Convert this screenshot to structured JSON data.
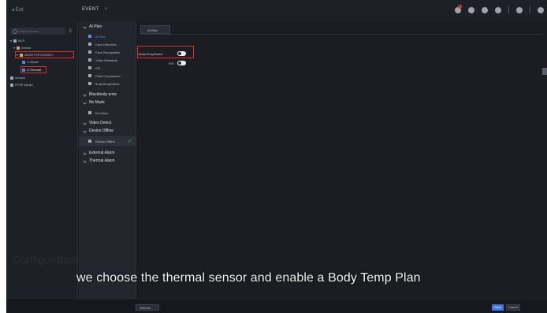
{
  "topbar": {
    "exit_label": "◂ Exit",
    "event_tab": "EVENT",
    "event_tab_plus": "+"
  },
  "devices": {
    "search_placeholder": "Search Device",
    "tree": [
      {
        "label": "NVS",
        "level": 0
      },
      {
        "label": "Device",
        "level": 1
      },
      {
        "label": "ANVR F2P4 E02027",
        "level": 2
      },
      {
        "label": "1-Visual",
        "level": 3
      },
      {
        "label": "2-Thermal",
        "level": 3
      },
      {
        "label": "Access",
        "level": 0
      },
      {
        "label": "RTSP Media",
        "level": 0
      }
    ]
  },
  "event_list": [
    {
      "label": "AI Plan",
      "kind": "header"
    },
    {
      "label": "AI Plan",
      "kind": "sub",
      "active": true
    },
    {
      "label": "Face Detection",
      "kind": "sub"
    },
    {
      "label": "Face Recognition",
      "kind": "sub"
    },
    {
      "label": "Video Metadata",
      "kind": "sub"
    },
    {
      "label": "IVS",
      "kind": "sub"
    },
    {
      "label": "Plate Comparison",
      "kind": "sub"
    },
    {
      "label": "BodyTempDetect",
      "kind": "sub"
    },
    {
      "label": "Blackbody error",
      "kind": "header"
    },
    {
      "label": "No Mask",
      "kind": "header"
    },
    {
      "label": "No Mask",
      "kind": "sub"
    },
    {
      "label": "Video Detect",
      "kind": "header"
    },
    {
      "label": "Device Offline",
      "kind": "header"
    },
    {
      "label": "Device Offline",
      "kind": "sub",
      "selected": true,
      "checked": true
    },
    {
      "label": "External Alarm",
      "kind": "header"
    },
    {
      "label": "Thermal Alarm",
      "kind": "header"
    }
  ],
  "main": {
    "plan_tab": "AI Plan",
    "options": [
      {
        "label": "BodyTempDetect",
        "enabled": true
      },
      {
        "label": "IVS",
        "enabled": true
      }
    ]
  },
  "bottombar": {
    "refresh_label": "Refresh",
    "save_label": "Save",
    "cancel_label": "Cancel"
  },
  "subtitle": "we choose the thermal sensor and enable a Body Temp Plan",
  "watermark": "Configuration",
  "colors": {
    "highlight": "#d8302a",
    "accent": "#3d7be0",
    "check": "#4fbf6a"
  }
}
